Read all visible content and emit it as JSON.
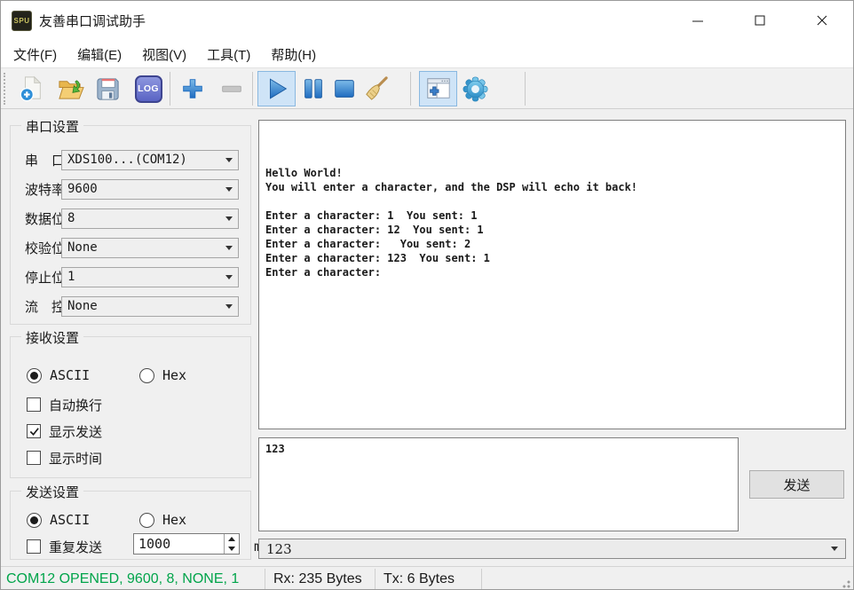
{
  "window": {
    "title": "友善串口调试助手",
    "app_icon_text": "SPU"
  },
  "menu": {
    "items": [
      "文件(F)",
      "编辑(E)",
      "视图(V)",
      "工具(T)",
      "帮助(H)"
    ]
  },
  "toolbar": {
    "log_label": "LOG",
    "icons": [
      "new-file",
      "open-folder",
      "save",
      "log",
      "add",
      "remove",
      "start",
      "pause",
      "stop",
      "clear",
      "panel-toggle",
      "settings"
    ],
    "active_icons": [
      "start",
      "panel-toggle"
    ],
    "disabled_icons": [
      "remove"
    ]
  },
  "serial_settings": {
    "title": "串口设置",
    "fields": [
      {
        "label": "串　口",
        "value": "XDS100...(COM12)"
      },
      {
        "label": "波特率",
        "value": "9600"
      },
      {
        "label": "数据位",
        "value": "8"
      },
      {
        "label": "校验位",
        "value": "None"
      },
      {
        "label": "停止位",
        "value": "1"
      },
      {
        "label": "流　控",
        "value": "None"
      }
    ]
  },
  "receive_settings": {
    "title": "接收设置",
    "radios": [
      {
        "label": "ASCII",
        "selected": true
      },
      {
        "label": "Hex",
        "selected": false
      }
    ],
    "checkboxes": [
      {
        "label": "自动换行",
        "checked": false
      },
      {
        "label": "显示发送",
        "checked": true
      },
      {
        "label": "显示时间",
        "checked": false
      }
    ]
  },
  "send_settings": {
    "title": "发送设置",
    "radios": [
      {
        "label": "ASCII",
        "selected": true
      },
      {
        "label": "Hex",
        "selected": false
      }
    ],
    "repeat": {
      "label": "重复发送",
      "checked": false,
      "value": "1000",
      "unit": "ms"
    }
  },
  "terminal": {
    "text": "\n\n\nHello World!\nYou will enter a character, and the DSP will echo it back!\n\nEnter a character: 1  You sent: 1\nEnter a character: 12  You sent: 1\nEnter a character:   You sent: 2\nEnter a character: 123  You sent: 1\nEnter a character: "
  },
  "send_area": {
    "text": "123",
    "send_button": "发送",
    "history_value": "123"
  },
  "status_bar": {
    "connection": "COM12 OPENED, 9600, 8, NONE, 1",
    "rx": "Rx: 235 Bytes",
    "tx": "Tx: 6 Bytes"
  },
  "colors": {
    "status_green": "#00A44A",
    "accent_blue": "#2E8FD8",
    "toolbar_highlight_bg": "#CFE4F7",
    "toolbar_highlight_border": "#89B8E0"
  }
}
